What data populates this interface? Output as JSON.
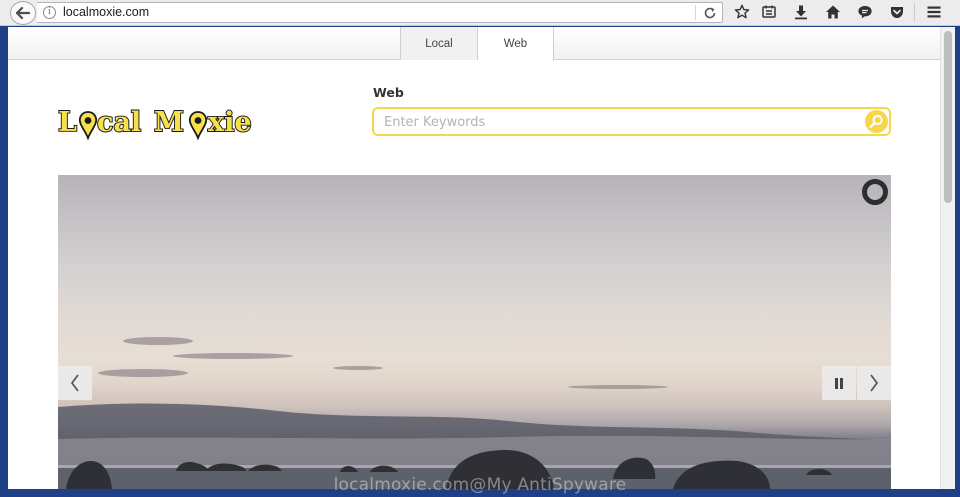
{
  "browser": {
    "url": "localmoxie.com",
    "toolbar_icons": [
      "back-arrow-icon",
      "info-icon",
      "reload-icon",
      "bookmark-star-icon",
      "reading-list-icon",
      "download-icon",
      "home-icon",
      "chat-icon",
      "pocket-icon",
      "hamburger-menu-icon"
    ]
  },
  "page": {
    "tabs": [
      {
        "label": "Local",
        "active": false
      },
      {
        "label": "Web",
        "active": true
      }
    ],
    "logo": {
      "text": "Local Moxie",
      "colors": {
        "fill": "#f7e04a",
        "outline": "#1a1a1a"
      }
    },
    "search": {
      "label": "Web",
      "placeholder": "Enter Keywords",
      "value": "",
      "border_color": "#f2d84a"
    },
    "slideshow": {
      "controls": [
        "prev-icon",
        "pause-icon",
        "next-icon"
      ],
      "loader": "loader-ring-icon"
    }
  },
  "watermark": "localmoxie.com@My AntiSpyware"
}
